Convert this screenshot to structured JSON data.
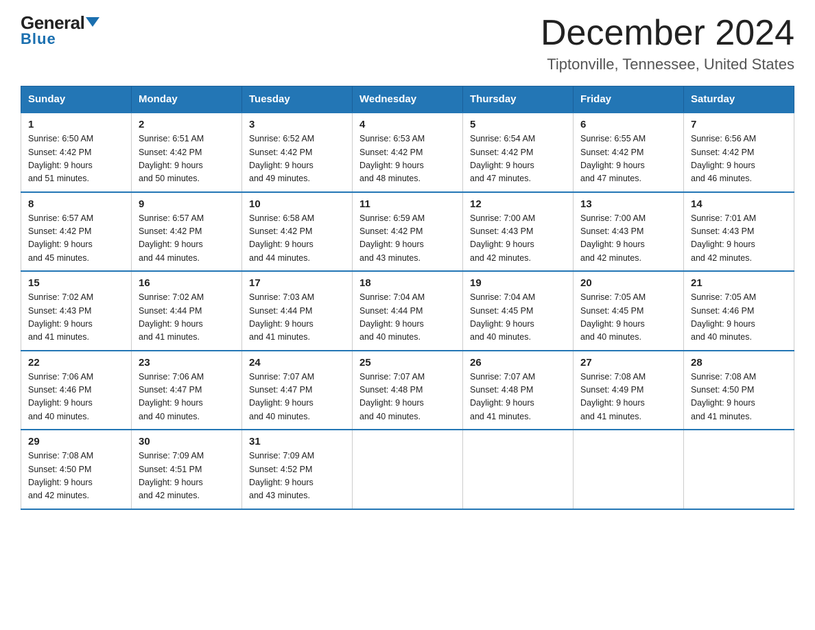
{
  "header": {
    "logo_line1": "General",
    "logo_line2": "Blue",
    "title": "December 2024",
    "subtitle": "Tiptonville, Tennessee, United States"
  },
  "days_of_week": [
    "Sunday",
    "Monday",
    "Tuesday",
    "Wednesday",
    "Thursday",
    "Friday",
    "Saturday"
  ],
  "weeks": [
    [
      {
        "day": "1",
        "sunrise": "6:50 AM",
        "sunset": "4:42 PM",
        "daylight": "9 hours and 51 minutes."
      },
      {
        "day": "2",
        "sunrise": "6:51 AM",
        "sunset": "4:42 PM",
        "daylight": "9 hours and 50 minutes."
      },
      {
        "day": "3",
        "sunrise": "6:52 AM",
        "sunset": "4:42 PM",
        "daylight": "9 hours and 49 minutes."
      },
      {
        "day": "4",
        "sunrise": "6:53 AM",
        "sunset": "4:42 PM",
        "daylight": "9 hours and 48 minutes."
      },
      {
        "day": "5",
        "sunrise": "6:54 AM",
        "sunset": "4:42 PM",
        "daylight": "9 hours and 47 minutes."
      },
      {
        "day": "6",
        "sunrise": "6:55 AM",
        "sunset": "4:42 PM",
        "daylight": "9 hours and 47 minutes."
      },
      {
        "day": "7",
        "sunrise": "6:56 AM",
        "sunset": "4:42 PM",
        "daylight": "9 hours and 46 minutes."
      }
    ],
    [
      {
        "day": "8",
        "sunrise": "6:57 AM",
        "sunset": "4:42 PM",
        "daylight": "9 hours and 45 minutes."
      },
      {
        "day": "9",
        "sunrise": "6:57 AM",
        "sunset": "4:42 PM",
        "daylight": "9 hours and 44 minutes."
      },
      {
        "day": "10",
        "sunrise": "6:58 AM",
        "sunset": "4:42 PM",
        "daylight": "9 hours and 44 minutes."
      },
      {
        "day": "11",
        "sunrise": "6:59 AM",
        "sunset": "4:42 PM",
        "daylight": "9 hours and 43 minutes."
      },
      {
        "day": "12",
        "sunrise": "7:00 AM",
        "sunset": "4:43 PM",
        "daylight": "9 hours and 42 minutes."
      },
      {
        "day": "13",
        "sunrise": "7:00 AM",
        "sunset": "4:43 PM",
        "daylight": "9 hours and 42 minutes."
      },
      {
        "day": "14",
        "sunrise": "7:01 AM",
        "sunset": "4:43 PM",
        "daylight": "9 hours and 42 minutes."
      }
    ],
    [
      {
        "day": "15",
        "sunrise": "7:02 AM",
        "sunset": "4:43 PM",
        "daylight": "9 hours and 41 minutes."
      },
      {
        "day": "16",
        "sunrise": "7:02 AM",
        "sunset": "4:44 PM",
        "daylight": "9 hours and 41 minutes."
      },
      {
        "day": "17",
        "sunrise": "7:03 AM",
        "sunset": "4:44 PM",
        "daylight": "9 hours and 41 minutes."
      },
      {
        "day": "18",
        "sunrise": "7:04 AM",
        "sunset": "4:44 PM",
        "daylight": "9 hours and 40 minutes."
      },
      {
        "day": "19",
        "sunrise": "7:04 AM",
        "sunset": "4:45 PM",
        "daylight": "9 hours and 40 minutes."
      },
      {
        "day": "20",
        "sunrise": "7:05 AM",
        "sunset": "4:45 PM",
        "daylight": "9 hours and 40 minutes."
      },
      {
        "day": "21",
        "sunrise": "7:05 AM",
        "sunset": "4:46 PM",
        "daylight": "9 hours and 40 minutes."
      }
    ],
    [
      {
        "day": "22",
        "sunrise": "7:06 AM",
        "sunset": "4:46 PM",
        "daylight": "9 hours and 40 minutes."
      },
      {
        "day": "23",
        "sunrise": "7:06 AM",
        "sunset": "4:47 PM",
        "daylight": "9 hours and 40 minutes."
      },
      {
        "day": "24",
        "sunrise": "7:07 AM",
        "sunset": "4:47 PM",
        "daylight": "9 hours and 40 minutes."
      },
      {
        "day": "25",
        "sunrise": "7:07 AM",
        "sunset": "4:48 PM",
        "daylight": "9 hours and 40 minutes."
      },
      {
        "day": "26",
        "sunrise": "7:07 AM",
        "sunset": "4:48 PM",
        "daylight": "9 hours and 41 minutes."
      },
      {
        "day": "27",
        "sunrise": "7:08 AM",
        "sunset": "4:49 PM",
        "daylight": "9 hours and 41 minutes."
      },
      {
        "day": "28",
        "sunrise": "7:08 AM",
        "sunset": "4:50 PM",
        "daylight": "9 hours and 41 minutes."
      }
    ],
    [
      {
        "day": "29",
        "sunrise": "7:08 AM",
        "sunset": "4:50 PM",
        "daylight": "9 hours and 42 minutes."
      },
      {
        "day": "30",
        "sunrise": "7:09 AM",
        "sunset": "4:51 PM",
        "daylight": "9 hours and 42 minutes."
      },
      {
        "day": "31",
        "sunrise": "7:09 AM",
        "sunset": "4:52 PM",
        "daylight": "9 hours and 43 minutes."
      },
      null,
      null,
      null,
      null
    ]
  ],
  "labels": {
    "sunrise": "Sunrise:",
    "sunset": "Sunset:",
    "daylight": "Daylight:"
  }
}
